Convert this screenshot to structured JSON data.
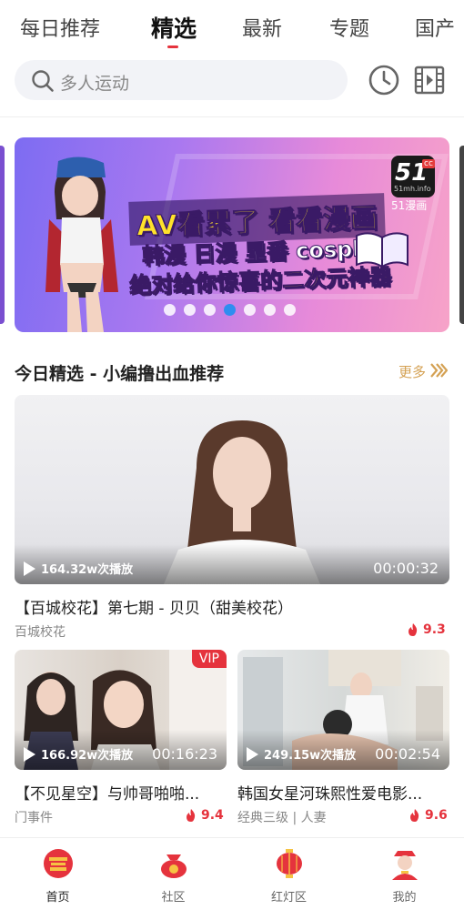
{
  "tabs": [
    "每日推荐",
    "精选",
    "最新",
    "专题",
    "国产"
  ],
  "active_tab": "精选",
  "search": {
    "placeholder": "多人运动"
  },
  "banner": {
    "line1": "AV看累了 看看漫画",
    "line2": "韩漫 日漫 里番 cosplay",
    "line3": "绝对给你惊喜的二次元神器",
    "logo_number": "51",
    "logo_sup": "cc",
    "logo_domain": "51mh.info",
    "logo_label": "51漫画",
    "page_count": 7,
    "active_page": 4
  },
  "section": {
    "title": "今日精选 - 小编撸出血推荐",
    "more": "更多"
  },
  "featured": {
    "plays": "164.32w次播放",
    "duration": "00:00:32",
    "title": "【百城校花】第七期 - 贝贝（甜美校花）",
    "tag": "百城校花",
    "rating": "9.3"
  },
  "grid": [
    {
      "plays": "166.92w次播放",
      "duration": "00:16:23",
      "vip": "VIP",
      "title": "【不见星空】与帅哥啪啪...",
      "tag": "门事件",
      "rating": "9.4"
    },
    {
      "plays": "249.15w次播放",
      "duration": "00:02:54",
      "title": "韩国女星河珠熙性爱电影...",
      "tag": "经典三级 | 人妻",
      "rating": "9.6"
    }
  ],
  "nav": [
    "首页",
    "社区",
    "红灯区",
    "我的"
  ],
  "colors": {
    "accent": "#e5333d",
    "gold": "#d4a153",
    "dot_active": "#2f8df0"
  }
}
